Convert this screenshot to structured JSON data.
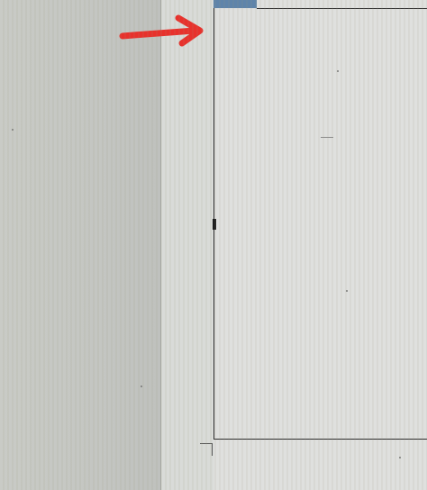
{
  "window": {
    "accent_color": "#5f84aa",
    "frame_color": "#2c2c2c"
  },
  "annotation": {
    "icon": "arrow-right-icon",
    "color": "#e8312c"
  }
}
